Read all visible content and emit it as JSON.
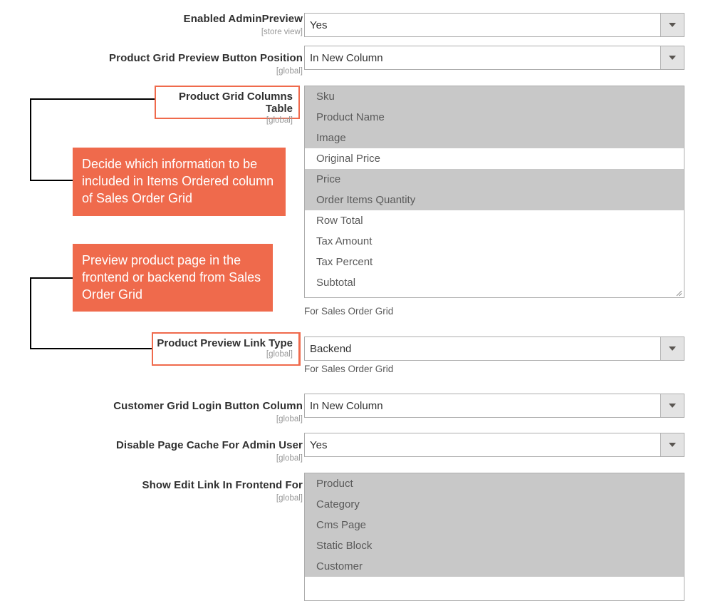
{
  "page": {
    "accent_color": "#ef6a4c",
    "selected_option_bg": "#c8c8c8",
    "background": "#ffffff"
  },
  "fields": [
    {
      "id": "enabled-admin-preview",
      "label": "Enabled AdminPreview",
      "scope": "[store view]",
      "type": "select",
      "value": "Yes"
    },
    {
      "id": "product-grid-preview-button-position",
      "label": "Product Grid Preview Button Position",
      "scope": "[global]",
      "type": "select",
      "value": "In New Column"
    },
    {
      "id": "product-grid-columns-table",
      "label": "Product Grid Columns Table",
      "scope": "[global]",
      "type": "multiselect",
      "highlighted": true,
      "hint": "For Sales Order Grid",
      "options": [
        {
          "label": "Sku",
          "selected": true
        },
        {
          "label": "Product Name",
          "selected": true
        },
        {
          "label": "Image",
          "selected": true
        },
        {
          "label": "Original Price",
          "selected": false
        },
        {
          "label": "Price",
          "selected": true
        },
        {
          "label": "Order Items Quantity",
          "selected": true
        },
        {
          "label": "Row Total",
          "selected": false
        },
        {
          "label": "Tax Amount",
          "selected": false
        },
        {
          "label": "Tax Percent",
          "selected": false
        },
        {
          "label": "Subtotal",
          "selected": false
        }
      ]
    },
    {
      "id": "product-preview-link-type",
      "label": "Product Preview Link Type",
      "scope": "[global]",
      "type": "select",
      "highlighted": true,
      "value": "Backend",
      "hint": "For Sales Order Grid"
    },
    {
      "id": "customer-grid-login-button-column",
      "label": "Customer Grid Login Button Column",
      "scope": "[global]",
      "type": "select",
      "value": "In New Column"
    },
    {
      "id": "disable-page-cache-for-admin-user",
      "label": "Disable Page Cache For Admin User",
      "scope": "[global]",
      "type": "select",
      "value": "Yes"
    },
    {
      "id": "show-edit-link-in-frontend-for",
      "label": "Show Edit Link In Frontend For",
      "scope": "[global]",
      "type": "multiselect",
      "options": [
        {
          "label": "Product",
          "selected": true
        },
        {
          "label": "Category",
          "selected": true
        },
        {
          "label": "Cms Page",
          "selected": true
        },
        {
          "label": "Static Block",
          "selected": true
        },
        {
          "label": "Customer",
          "selected": true
        }
      ]
    }
  ],
  "annotations": [
    {
      "id": "items-ordered-note",
      "text": "Decide which information to be included in Items Ordered column of Sales Order Grid"
    },
    {
      "id": "preview-product-note",
      "text": "Preview product page in the frontend or backend from Sales Order Grid"
    }
  ]
}
